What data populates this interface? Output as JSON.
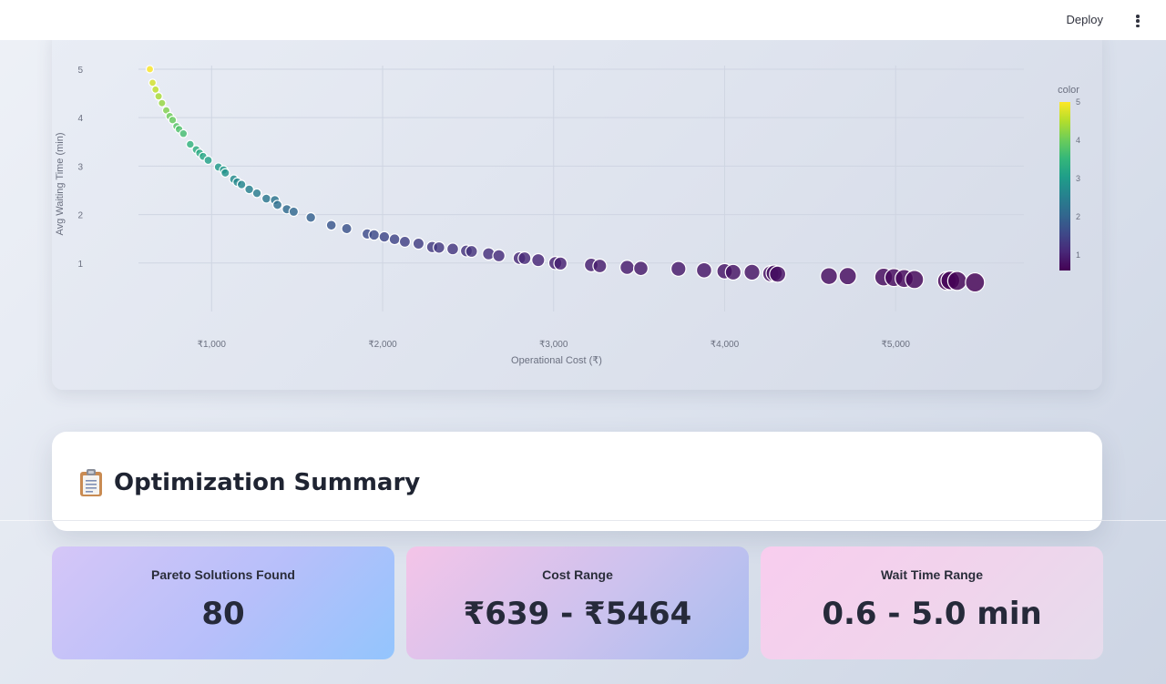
{
  "toolbar": {
    "deploy_label": "Deploy",
    "menu_icon": "more-vertical-icon"
  },
  "colors": {
    "card_bg": "#ffffff",
    "text_dark": "#262a3a"
  },
  "chart_data": {
    "type": "scatter",
    "title": "",
    "xlabel": "Operational Cost (₹)",
    "ylabel": "Avg Waiting Time (min)",
    "xlim": [
      290,
      5750
    ],
    "ylim": [
      0.0,
      5.3
    ],
    "x_ticks": [
      1000,
      2000,
      3000,
      4000,
      5000
    ],
    "x_tick_labels": [
      "₹1,000",
      "₹2,000",
      "₹3,000",
      "₹4,000",
      "₹5,000"
    ],
    "y_ticks": [
      1,
      2,
      3,
      4,
      5
    ],
    "y_tick_labels": [
      "1",
      "2",
      "3",
      "4",
      "5"
    ],
    "grid": true,
    "colorscale": "viridis",
    "colorbar": {
      "title": "color",
      "min": 0.6,
      "max": 5.0,
      "ticks": [
        "1",
        "2",
        "3",
        "4",
        "5"
      ]
    },
    "points": [
      {
        "x": 639,
        "y": 5.0
      },
      {
        "x": 655,
        "y": 4.72
      },
      {
        "x": 672,
        "y": 4.58
      },
      {
        "x": 690,
        "y": 4.44
      },
      {
        "x": 710,
        "y": 4.3
      },
      {
        "x": 735,
        "y": 4.15
      },
      {
        "x": 755,
        "y": 4.03
      },
      {
        "x": 772,
        "y": 3.95
      },
      {
        "x": 795,
        "y": 3.82
      },
      {
        "x": 810,
        "y": 3.76
      },
      {
        "x": 835,
        "y": 3.67
      },
      {
        "x": 875,
        "y": 3.45
      },
      {
        "x": 910,
        "y": 3.34
      },
      {
        "x": 930,
        "y": 3.27
      },
      {
        "x": 950,
        "y": 3.2
      },
      {
        "x": 980,
        "y": 3.12
      },
      {
        "x": 1040,
        "y": 2.98
      },
      {
        "x": 1070,
        "y": 2.92
      },
      {
        "x": 1080,
        "y": 2.86
      },
      {
        "x": 1130,
        "y": 2.73
      },
      {
        "x": 1150,
        "y": 2.67
      },
      {
        "x": 1175,
        "y": 2.62
      },
      {
        "x": 1220,
        "y": 2.52
      },
      {
        "x": 1265,
        "y": 2.44
      },
      {
        "x": 1320,
        "y": 2.33
      },
      {
        "x": 1370,
        "y": 2.3
      },
      {
        "x": 1385,
        "y": 2.2
      },
      {
        "x": 1440,
        "y": 2.11
      },
      {
        "x": 1480,
        "y": 2.06
      },
      {
        "x": 1580,
        "y": 1.94
      },
      {
        "x": 1700,
        "y": 1.78
      },
      {
        "x": 1790,
        "y": 1.71
      },
      {
        "x": 1910,
        "y": 1.6
      },
      {
        "x": 1950,
        "y": 1.58
      },
      {
        "x": 2010,
        "y": 1.54
      },
      {
        "x": 2070,
        "y": 1.49
      },
      {
        "x": 2130,
        "y": 1.44
      },
      {
        "x": 2210,
        "y": 1.4
      },
      {
        "x": 2290,
        "y": 1.33
      },
      {
        "x": 2330,
        "y": 1.32
      },
      {
        "x": 2410,
        "y": 1.29
      },
      {
        "x": 2490,
        "y": 1.25
      },
      {
        "x": 2520,
        "y": 1.24
      },
      {
        "x": 2620,
        "y": 1.19
      },
      {
        "x": 2680,
        "y": 1.15
      },
      {
        "x": 2800,
        "y": 1.1
      },
      {
        "x": 2830,
        "y": 1.1
      },
      {
        "x": 2910,
        "y": 1.06
      },
      {
        "x": 3010,
        "y": 1.0
      },
      {
        "x": 3040,
        "y": 0.99
      },
      {
        "x": 3220,
        "y": 0.96
      },
      {
        "x": 3270,
        "y": 0.94
      },
      {
        "x": 3430,
        "y": 0.91
      },
      {
        "x": 3510,
        "y": 0.89
      },
      {
        "x": 3730,
        "y": 0.88
      },
      {
        "x": 3880,
        "y": 0.85
      },
      {
        "x": 4000,
        "y": 0.83
      },
      {
        "x": 4050,
        "y": 0.81
      },
      {
        "x": 4160,
        "y": 0.81
      },
      {
        "x": 4270,
        "y": 0.78
      },
      {
        "x": 4290,
        "y": 0.79
      },
      {
        "x": 4310,
        "y": 0.77
      },
      {
        "x": 4610,
        "y": 0.73
      },
      {
        "x": 4720,
        "y": 0.73
      },
      {
        "x": 4930,
        "y": 0.71
      },
      {
        "x": 4990,
        "y": 0.7
      },
      {
        "x": 5050,
        "y": 0.68
      },
      {
        "x": 5110,
        "y": 0.66
      },
      {
        "x": 5300,
        "y": 0.63
      },
      {
        "x": 5320,
        "y": 0.64
      },
      {
        "x": 5360,
        "y": 0.63
      },
      {
        "x": 5464,
        "y": 0.6
      }
    ]
  },
  "summary": {
    "icon": "clipboard-icon",
    "title": "Optimization Summary"
  },
  "metrics": [
    {
      "label": "Pareto Solutions Found",
      "value": "80"
    },
    {
      "label": "Cost Range",
      "value": "₹639 - ₹5464"
    },
    {
      "label": "Wait Time Range",
      "value": "0.6 - 5.0 min"
    }
  ]
}
